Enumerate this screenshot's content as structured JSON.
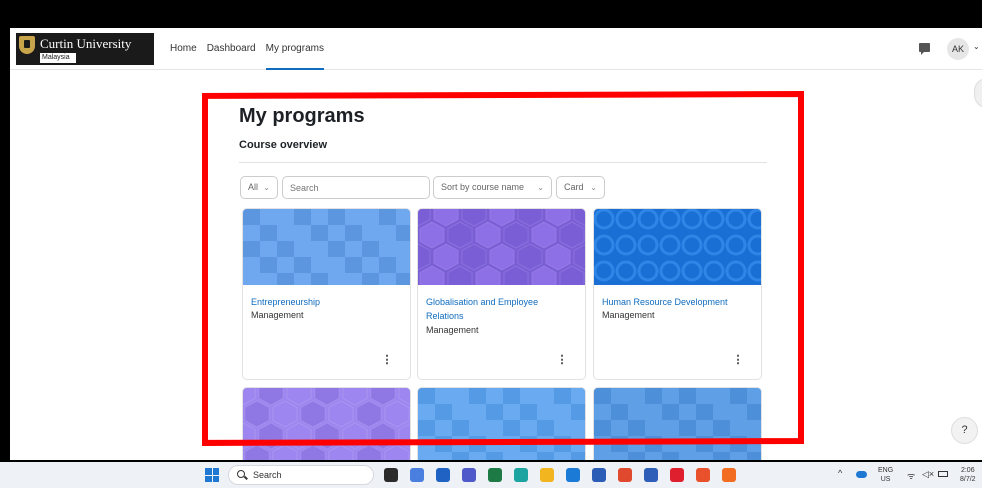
{
  "navbar": {
    "logo_name": "Curtin University",
    "logo_sub": "Malaysia",
    "links": [
      {
        "label": "Home"
      },
      {
        "label": "Dashboard"
      },
      {
        "label": "My programs",
        "active": true
      }
    ],
    "avatar": "AK",
    "avatar_caret": "⌄"
  },
  "main": {
    "title": "My programs",
    "section": "Course overview",
    "filters": {
      "status": "All",
      "search_placeholder": "Search",
      "sort": "Sort by course name",
      "view": "Card"
    },
    "courses": [
      {
        "name": "Entrepreneurship",
        "category": "Management",
        "menu": "⋮",
        "colors": [
          "#6fa8ef",
          "#5b96de"
        ]
      },
      {
        "name": "Globalisation and Employee Relations",
        "category": "Management",
        "menu": "⋮",
        "colors": [
          "#7a5ed6",
          "#8d6fe6"
        ]
      },
      {
        "name": "Human Resource Development",
        "category": "Management",
        "menu": "⋮",
        "colors": [
          "#1a6fd4",
          "#2f86e6"
        ]
      },
      {
        "name": "",
        "category": "",
        "menu": "",
        "colors": [
          "#9d86ef",
          "#8f78e4"
        ]
      },
      {
        "name": "",
        "category": "",
        "menu": "",
        "colors": [
          "#6aaaf0",
          "#559ae4"
        ]
      },
      {
        "name": "",
        "category": "",
        "menu": "",
        "colors": [
          "#5e9fe6",
          "#4d8fd9"
        ]
      }
    ],
    "help": "?"
  },
  "taskbar": {
    "search": "Search",
    "apps": [
      {
        "icon": "file-explorer-icon",
        "color": "#2b2b2b"
      },
      {
        "icon": "copilot-icon",
        "color": "#4a7fe0"
      },
      {
        "icon": "store-icon",
        "color": "#1f62c4"
      },
      {
        "icon": "teams-icon",
        "color": "#5059c9"
      },
      {
        "icon": "excel-icon",
        "color": "#1d7a45"
      },
      {
        "icon": "edge-icon",
        "color": "#1ea4a0"
      },
      {
        "icon": "folder-icon",
        "color": "#f2b51f"
      },
      {
        "icon": "calculator-icon",
        "color": "#1b7ad6"
      },
      {
        "icon": "word-icon",
        "color": "#2b5db7"
      },
      {
        "icon": "pdf-icon",
        "color": "#e0492e"
      },
      {
        "icon": "app-icon",
        "color": "#2e5eb8"
      },
      {
        "icon": "opera-icon",
        "color": "#e01f2e"
      },
      {
        "icon": "brave-icon",
        "color": "#e8512b"
      },
      {
        "icon": "figma-icon",
        "color": "#f26d22"
      }
    ],
    "tray_caret": "^",
    "lang_1": "ENG",
    "lang_2": "US",
    "wifi": "ᯤ",
    "volume": "◁×",
    "time_1": "2:06",
    "time_2": "8/7/2"
  }
}
